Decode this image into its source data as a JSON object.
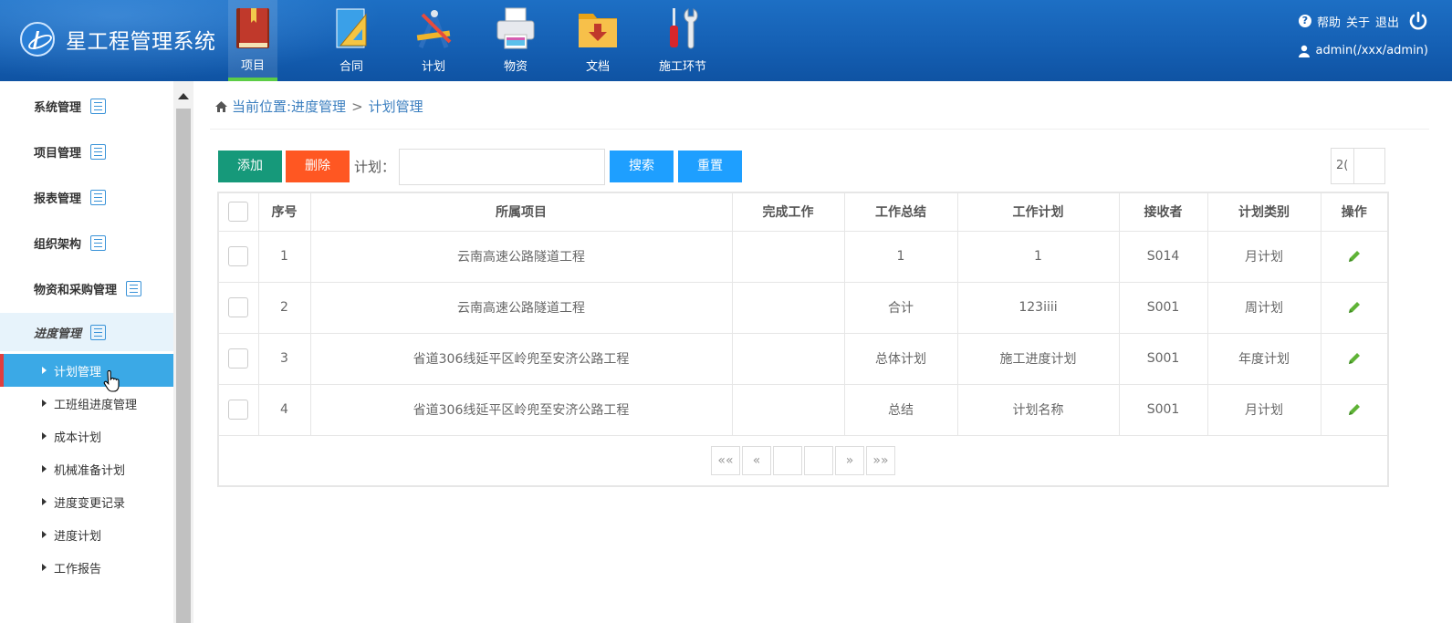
{
  "app": {
    "title": "星工程管理系统"
  },
  "topnav": [
    {
      "label": "项目",
      "icon": "book-icon",
      "active": true
    },
    {
      "label": "合同",
      "icon": "ruler-triangle-icon"
    },
    {
      "label": "计划",
      "icon": "drafting-tools-icon"
    },
    {
      "label": "物资",
      "icon": "printer-icon"
    },
    {
      "label": "文档",
      "icon": "folder-download-icon"
    },
    {
      "label": "施工环节",
      "icon": "screwdriver-wrench-icon"
    }
  ],
  "header_right": {
    "help": "帮助",
    "about": "关于",
    "logout": "退出",
    "user": "admin(/xxx/admin)"
  },
  "sidebar": {
    "groups": [
      {
        "label": "系统管理"
      },
      {
        "label": "项目管理"
      },
      {
        "label": "报表管理"
      },
      {
        "label": "组织架构"
      },
      {
        "label": "物资和采购管理"
      },
      {
        "label": "进度管理",
        "active": true
      }
    ],
    "sub_items": [
      {
        "label": "计划管理",
        "active": true
      },
      {
        "label": "工班组进度管理"
      },
      {
        "label": "成本计划"
      },
      {
        "label": "机械准备计划"
      },
      {
        "label": "进度变更记录"
      },
      {
        "label": "进度计划"
      },
      {
        "label": "工作报告"
      }
    ]
  },
  "breadcrumb": {
    "prefix": "当前位置:进度管理",
    "sep": ">",
    "current": "计划管理"
  },
  "toolbar": {
    "add": "添加",
    "delete": "删除",
    "plan_label": "计划：",
    "plan_value": "",
    "search": "搜索",
    "reset": "重置",
    "page_size": "2("
  },
  "table": {
    "columns": [
      "序号",
      "所属项目",
      "完成工作",
      "工作总结",
      "工作计划",
      "接收者",
      "计划类别",
      "操作"
    ],
    "rows": [
      {
        "no": "1",
        "project": "云南高速公路隧道工程",
        "done": "",
        "summary": "1",
        "plan": "1",
        "receiver": "S014",
        "type": "月计划"
      },
      {
        "no": "2",
        "project": "云南高速公路隧道工程",
        "done": "",
        "summary": "合计",
        "plan": "123iiii",
        "receiver": "S001",
        "type": "周计划"
      },
      {
        "no": "3",
        "project": "省道306线延平区岭兜至安济公路工程",
        "done": "",
        "summary": "总体计划",
        "plan": "施工进度计划",
        "receiver": "S001",
        "type": "年度计划"
      },
      {
        "no": "4",
        "project": "省道306线延平区岭兜至安济公路工程",
        "done": "",
        "summary": "总结",
        "plan": "计划名称",
        "receiver": "S001",
        "type": "月计划"
      }
    ]
  },
  "pager": {
    "first": "««",
    "prev": "«",
    "next": "»",
    "last": "»»"
  },
  "colors": {
    "header": "#1560b4",
    "add": "#16997a",
    "delete": "#ff5722",
    "primary": "#1e9fff",
    "active_side": "#3ba9e6",
    "nav_active_bar": "#5ccd46",
    "edit": "#5fb336"
  }
}
